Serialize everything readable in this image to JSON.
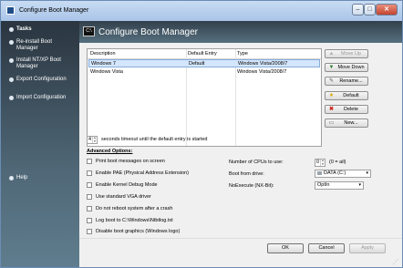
{
  "window": {
    "title": "Configure Boot Manager"
  },
  "sidebar": {
    "items": [
      {
        "label": "Tasks"
      },
      {
        "label": "Re-install Boot\nManager"
      },
      {
        "label": "Install NT/XP Boot\nManager"
      },
      {
        "label": "Export Configuration"
      },
      {
        "label": "Import Configuration"
      },
      {
        "label": "Help"
      }
    ]
  },
  "header": {
    "title": "Configure Boot Manager",
    "icon_text": "C:\\"
  },
  "entries": {
    "columns": [
      "Description",
      "Default Entry",
      "Type"
    ],
    "rows": [
      {
        "description": "Windows 7",
        "default": "Default",
        "type": "Windows Vista/2008/7"
      },
      {
        "description": "Windows Vista",
        "default": "",
        "type": "Windows Vista/2008/7"
      }
    ]
  },
  "side_buttons": {
    "move_up": "Move Up",
    "move_down": "Move Down",
    "rename": "Rename...",
    "default": "Default",
    "delete": "Delete",
    "new": "New..."
  },
  "timeout": {
    "value": "4",
    "label": "seconds timeout until the default entry is started"
  },
  "advanced": {
    "title": "Advanced Options:",
    "options": [
      "Print boot messages on screen",
      "Enable PAE (Physical Address Extension)",
      "Enable Kernel Debug Mode",
      "Use standard VGA driver",
      "Do not reboot system after a crash",
      "Log boot to C:\\Windows\\Ntbtlog.txt",
      "Disable boot graphics (Windows logo)"
    ]
  },
  "cpus": {
    "label": "Number of CPUs to use:",
    "value": "0",
    "hint": "(0 = all)"
  },
  "boot_drive": {
    "label": "Boot from drive:",
    "value": "DATA (C:)"
  },
  "noexecute": {
    "label": "NoExecute (NX-Bit):",
    "value": "OptIn"
  },
  "footer": {
    "ok": "OK",
    "cancel": "Cancel",
    "apply": "Apply"
  }
}
